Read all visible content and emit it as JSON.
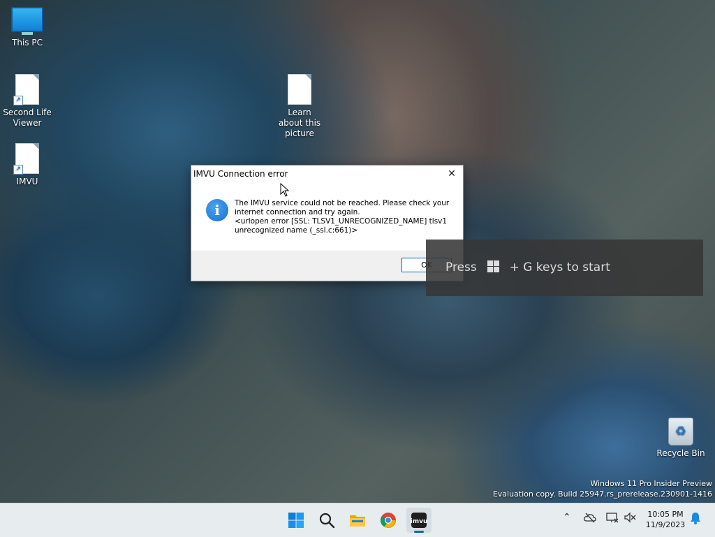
{
  "desktop": {
    "icons": [
      {
        "label": "This PC"
      },
      {
        "label": "Second Life Viewer"
      },
      {
        "label": "IMVU"
      },
      {
        "label": "Learn about this picture"
      },
      {
        "label": "Recycle Bin"
      }
    ]
  },
  "dialog": {
    "title": "IMVU Connection error",
    "message_line1": "The IMVU service could not be reached. Please check your internet connection and try again.",
    "message_line2": "<urlopen error [SSL: TLSV1_UNRECOGNIZED_NAME] tlsv1 unrecognized name (_ssl.c:661)>",
    "ok_label": "OK",
    "close_glyph": "✕"
  },
  "gamebar": {
    "press": "Press",
    "suffix": "+ G keys to start"
  },
  "watermark": {
    "line1": "Windows 11 Pro Insider Preview",
    "line2": "Evaluation copy. Build 25947.rs_prerelease.230901-1416"
  },
  "taskbar": {
    "time": "10:05 PM",
    "date": "11/9/2023"
  },
  "colors": {
    "accent": "#0067c0",
    "info_icon": "#1a6fd0"
  }
}
